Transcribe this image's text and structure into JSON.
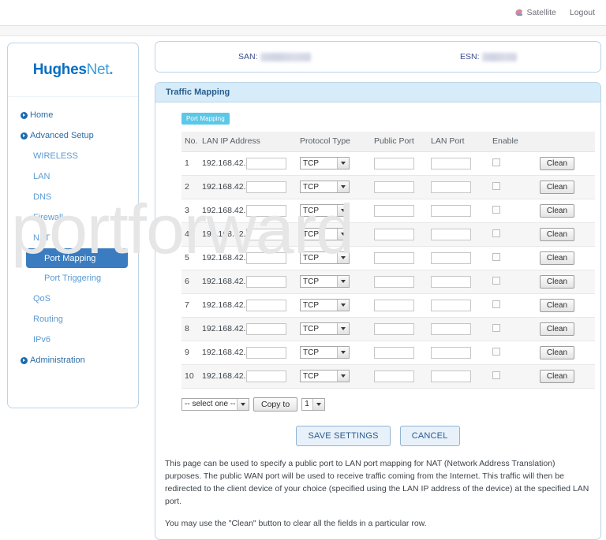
{
  "topbar": {
    "satellite_label": "Satellite",
    "logout_label": "Logout"
  },
  "sidebar": {
    "logo": {
      "part_a": "Hughes",
      "part_b": "Net",
      "dot": "."
    },
    "items": [
      {
        "label": "Home",
        "level": "top",
        "active": false,
        "bullet": true
      },
      {
        "label": "Advanced Setup",
        "level": "top",
        "active": false,
        "bullet": true
      },
      {
        "label": "WIRELESS",
        "level": "sub",
        "active": false,
        "bullet": false
      },
      {
        "label": "LAN",
        "level": "sub",
        "active": false,
        "bullet": false
      },
      {
        "label": "DNS",
        "level": "sub",
        "active": false,
        "bullet": false
      },
      {
        "label": "Firewall",
        "level": "sub",
        "active": false,
        "bullet": false
      },
      {
        "label": "NAT",
        "level": "sub",
        "active": false,
        "bullet": false
      },
      {
        "label": "Port Mapping",
        "level": "subsub",
        "active": true,
        "bullet": false
      },
      {
        "label": "Port Triggering",
        "level": "subsub",
        "active": false,
        "bullet": false
      },
      {
        "label": "QoS",
        "level": "sub",
        "active": false,
        "bullet": false
      },
      {
        "label": "Routing",
        "level": "sub",
        "active": false,
        "bullet": false
      },
      {
        "label": "IPv6",
        "level": "sub",
        "active": false,
        "bullet": false
      },
      {
        "label": "Administration",
        "level": "top",
        "active": false,
        "bullet": true
      }
    ]
  },
  "idbar": {
    "san_label": "SAN:",
    "san_value": "",
    "esn_label": "ESN:",
    "esn_value": ""
  },
  "panel": {
    "title": "Traffic Mapping",
    "tab_label": "Port Mapping"
  },
  "table": {
    "headers": [
      "No.",
      "LAN IP Address",
      "Protocol Type",
      "Public Port",
      "LAN Port",
      "Enable",
      ""
    ],
    "ip_prefix": "192.168.42.",
    "clean_label": "Clean",
    "rows": [
      {
        "no": "1",
        "ip_suffix": "",
        "protocol": "TCP",
        "public_port": "",
        "lan_port": "",
        "enabled": false
      },
      {
        "no": "2",
        "ip_suffix": "",
        "protocol": "TCP",
        "public_port": "",
        "lan_port": "",
        "enabled": false
      },
      {
        "no": "3",
        "ip_suffix": "",
        "protocol": "TCP",
        "public_port": "",
        "lan_port": "",
        "enabled": false
      },
      {
        "no": "4",
        "ip_suffix": "",
        "protocol": "TCP",
        "public_port": "",
        "lan_port": "",
        "enabled": false
      },
      {
        "no": "5",
        "ip_suffix": "",
        "protocol": "TCP",
        "public_port": "",
        "lan_port": "",
        "enabled": false
      },
      {
        "no": "6",
        "ip_suffix": "",
        "protocol": "TCP",
        "public_port": "",
        "lan_port": "",
        "enabled": false
      },
      {
        "no": "7",
        "ip_suffix": "",
        "protocol": "TCP",
        "public_port": "",
        "lan_port": "",
        "enabled": false
      },
      {
        "no": "8",
        "ip_suffix": "",
        "protocol": "TCP",
        "public_port": "",
        "lan_port": "",
        "enabled": false
      },
      {
        "no": "9",
        "ip_suffix": "",
        "protocol": "TCP",
        "public_port": "",
        "lan_port": "",
        "enabled": false
      },
      {
        "no": "10",
        "ip_suffix": "",
        "protocol": "TCP",
        "public_port": "",
        "lan_port": "",
        "enabled": false
      }
    ]
  },
  "controls": {
    "select_one_value": "-- select one --",
    "copy_to_label": "Copy to",
    "row_target_value": "1"
  },
  "actions": {
    "save_label": "SAVE SETTINGS",
    "cancel_label": "CANCEL"
  },
  "notes": {
    "paragraph_1": "This page can be used to specify a public port to LAN port mapping for NAT (Network Address Translation) purposes. The public WAN port will be used to receive traffic coming from the Internet. This traffic will then be redirected to the client device of your choice (specified using the LAN IP address of the device) at the specified LAN port.",
    "paragraph_2": "You may use the \"Clean\" button to clear all the fields in a particular row."
  },
  "watermark": {
    "text": "portforward"
  },
  "colors": {
    "brand_blue": "#0a6fc2",
    "brand_light_blue": "#3f9ddd",
    "active_nav": "#3a7cbf",
    "panel_header": "#d6ecf8",
    "tab_badge": "#5bc8e8",
    "panel_border": "#bcd4e6"
  }
}
